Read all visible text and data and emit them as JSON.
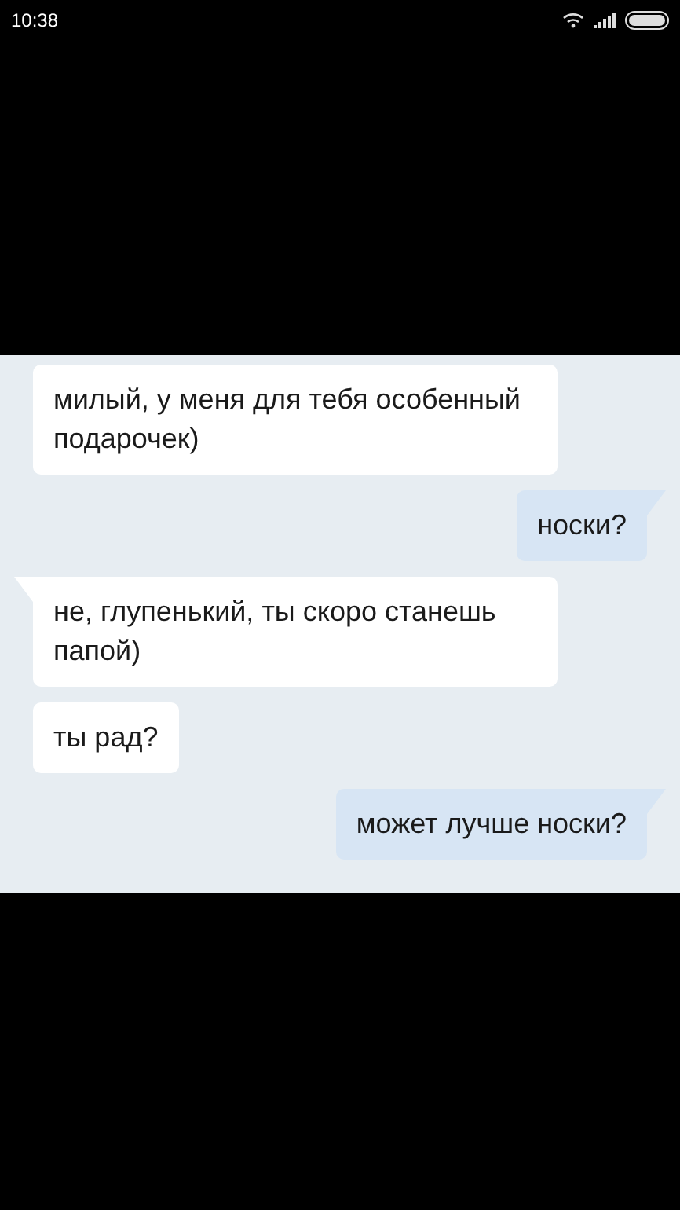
{
  "status_bar": {
    "time": "10:38"
  },
  "messages": [
    {
      "kind": "incoming",
      "tail": false,
      "text": "милый, у меня для тебя особенный подарочек)"
    },
    {
      "kind": "outgoing",
      "tail": true,
      "text": "носки?"
    },
    {
      "kind": "incoming",
      "tail": true,
      "text": "не, глупенький, ты скоро станешь папой)"
    },
    {
      "kind": "incoming",
      "tail": false,
      "text": "ты рад?"
    },
    {
      "kind": "outgoing",
      "tail": true,
      "text": "может лучше носки?"
    }
  ]
}
